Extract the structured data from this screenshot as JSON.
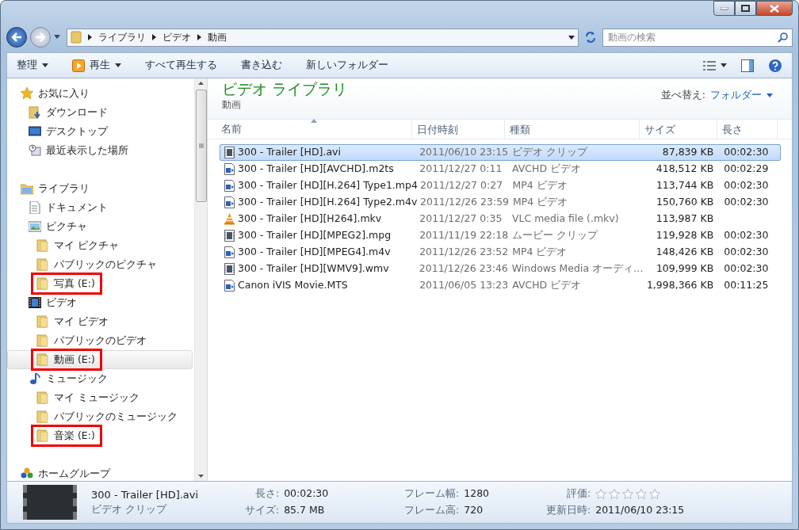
{
  "address": {
    "crumbs": [
      "ライブラリ",
      "ビデオ",
      "動画"
    ]
  },
  "search": {
    "placeholder": "動画の検索"
  },
  "toolbar": [
    {
      "label": "整理",
      "kind": "menu"
    },
    {
      "label": "再生",
      "kind": "play"
    },
    {
      "label": "すべて再生する",
      "kind": "plain"
    },
    {
      "label": "書き込む",
      "kind": "plain"
    },
    {
      "label": "新しいフォルダー",
      "kind": "plain"
    }
  ],
  "sidebar": {
    "groups": [
      {
        "label": "お気に入り",
        "kind": "star",
        "selected": false,
        "highlighted": false,
        "children": [
          {
            "label": "ダウンロード",
            "kind": "download",
            "selected": false,
            "highlighted": false
          },
          {
            "label": "デスクトップ",
            "kind": "desktop",
            "selected": false,
            "highlighted": false
          },
          {
            "label": "最近表示した場所",
            "kind": "recent",
            "selected": false,
            "highlighted": false
          }
        ]
      },
      {
        "label": "ライブラリ",
        "kind": "library",
        "selected": false,
        "highlighted": false,
        "children": [
          {
            "label": "ドキュメント",
            "kind": "document",
            "selected": false,
            "highlighted": false
          },
          {
            "label": "ピクチャ",
            "kind": "pictures",
            "selected": false,
            "highlighted": false,
            "children": [
              {
                "label": "マイ ピクチャ",
                "kind": "folder",
                "selected": false,
                "highlighted": false
              },
              {
                "label": "パブリックのピクチャ",
                "kind": "folder",
                "selected": false,
                "highlighted": false
              },
              {
                "label": "写真 (E:)",
                "kind": "folder",
                "selected": false,
                "highlighted": true
              }
            ]
          },
          {
            "label": "ビデオ",
            "kind": "video",
            "selected": false,
            "highlighted": false,
            "children": [
              {
                "label": "マイ ビデオ",
                "kind": "folder",
                "selected": false,
                "highlighted": false
              },
              {
                "label": "パブリックのビデオ",
                "kind": "folder",
                "selected": false,
                "highlighted": false
              },
              {
                "label": "動画 (E:)",
                "kind": "folder",
                "selected": true,
                "highlighted": true
              }
            ]
          },
          {
            "label": "ミュージック",
            "kind": "music",
            "selected": false,
            "highlighted": false,
            "children": [
              {
                "label": "マイ ミュージック",
                "kind": "folder",
                "selected": false,
                "highlighted": false
              },
              {
                "label": "パブリックのミュージック",
                "kind": "folder",
                "selected": false,
                "highlighted": false
              },
              {
                "label": "音楽 (E:)",
                "kind": "folder",
                "selected": false,
                "highlighted": true
              }
            ]
          }
        ]
      },
      {
        "label": "ホームグループ",
        "kind": "homegroup",
        "selected": false,
        "highlighted": false
      }
    ]
  },
  "library": {
    "title": "ビデオ ライブラリ",
    "subtitle": "動画",
    "sort_label": "並べ替え:",
    "sort_value": "フォルダー"
  },
  "table": {
    "columns": [
      {
        "label": "名前",
        "sorted": true
      },
      {
        "label": "日付時刻",
        "sorted": false
      },
      {
        "label": "種類",
        "sorted": false
      },
      {
        "label": "サイズ",
        "sorted": false
      },
      {
        "label": "長さ",
        "sorted": false
      }
    ],
    "rows": [
      {
        "kind": "film",
        "selected": true,
        "cells": [
          "300 - Trailer [HD].avi",
          "2011/06/10 23:15",
          "ビデオ クリップ",
          "87,839 KB",
          "00:02:30"
        ]
      },
      {
        "kind": "media",
        "selected": false,
        "cells": [
          "300 - Trailer [HD][AVCHD].m2ts",
          "2011/12/27 0:11",
          "AVCHD ビデオ",
          "418,512 KB",
          "00:02:29"
        ]
      },
      {
        "kind": "media",
        "selected": false,
        "cells": [
          "300 - Trailer [HD][H.264] Type1.mp4",
          "2011/12/27 0:27",
          "MP4 ビデオ",
          "113,744 KB",
          "00:02:30"
        ]
      },
      {
        "kind": "media",
        "selected": false,
        "cells": [
          "300 - Trailer [HD][H.264] Type2.m4v",
          "2011/12/26 23:59",
          "MP4 ビデオ",
          "150,760 KB",
          "00:02:30"
        ]
      },
      {
        "kind": "cone",
        "selected": false,
        "cells": [
          "300 - Trailer [HD][H264].mkv",
          "2011/12/27 0:35",
          "VLC media file (.mkv)",
          "113,987 KB",
          ""
        ]
      },
      {
        "kind": "film",
        "selected": false,
        "cells": [
          "300 - Trailer [HD][MPEG2].mpg",
          "2011/11/19 22:18",
          "ムービー クリップ",
          "119,928 KB",
          "00:02:30"
        ]
      },
      {
        "kind": "media",
        "selected": false,
        "cells": [
          "300 - Trailer [HD][MPEG4].m4v",
          "2011/12/26 23:52",
          "MP4 ビデオ",
          "148,426 KB",
          "00:02:30"
        ]
      },
      {
        "kind": "film",
        "selected": false,
        "cells": [
          "300 - Trailer [HD][WMV9].wmv",
          "2011/12/26 23:46",
          "Windows Media オーディ…",
          "109,999 KB",
          "00:02:30"
        ]
      },
      {
        "kind": "media",
        "selected": false,
        "cells": [
          "Canon iVIS Movie.MTS",
          "2011/06/05 13:23",
          "AVCHD ビデオ",
          "1,998,366 KB",
          "00:11:25"
        ]
      }
    ]
  },
  "details": {
    "name": "300 - Trailer [HD].avi",
    "type": "ビデオ クリップ",
    "props": [
      {
        "label": "長さ:",
        "value": "00:02:30"
      },
      {
        "label": "フレーム幅:",
        "value": "1280"
      },
      {
        "label": "サイズ:",
        "value": "85.7 MB"
      },
      {
        "label": "フレーム高:",
        "value": "720"
      }
    ],
    "rating_label": "評価:",
    "stars": 0,
    "modified_label": "更新日時:",
    "modified_value": "2011/06/10 23:15"
  }
}
